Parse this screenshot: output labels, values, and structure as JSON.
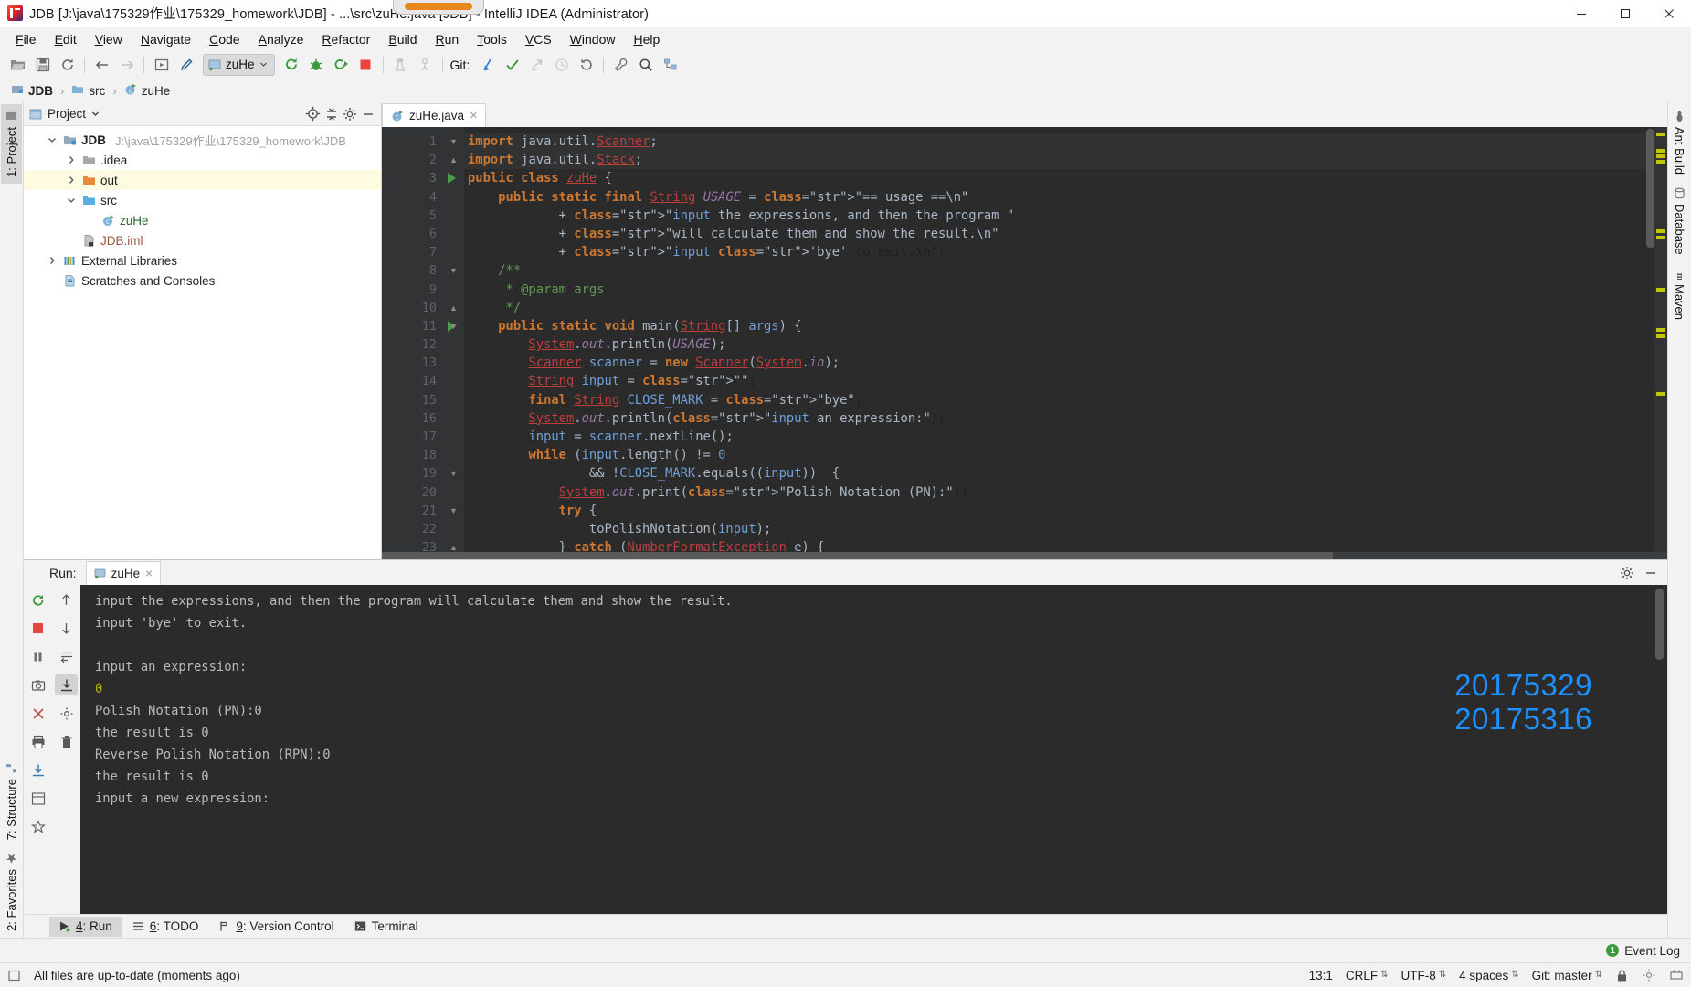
{
  "window": {
    "title": "JDB [J:\\java\\175329作业\\175329_homework\\JDB] - ...\\src\\zuHe.java [JDB] - IntelliJ IDEA (Administrator)",
    "minimize_label": "minimize",
    "maximize_label": "maximize",
    "close_label": "close"
  },
  "menu": {
    "items": [
      "File",
      "Edit",
      "View",
      "Navigate",
      "Code",
      "Analyze",
      "Refactor",
      "Build",
      "Run",
      "Tools",
      "VCS",
      "Window",
      "Help"
    ]
  },
  "toolbar": {
    "run_config": "zuHe",
    "git_label": "Git:",
    "buttons": [
      "open-project",
      "save-all",
      "sync",
      "back",
      "forward",
      "compile",
      "search-everywhere",
      "run",
      "debug",
      "run-with-coverage",
      "stop",
      "profile",
      "attach",
      "update-project",
      "commit",
      "push",
      "history",
      "rollback",
      "settings",
      "search",
      "structure"
    ]
  },
  "breadcrumb": {
    "items": [
      "JDB",
      "src",
      "zuHe"
    ]
  },
  "left_rail": {
    "tabs": [
      "1: Project",
      "7: Structure",
      "2: Favorites"
    ]
  },
  "right_rail": {
    "tabs": [
      "Ant Build",
      "Database",
      "Maven"
    ]
  },
  "project_panel": {
    "title": "Project",
    "tree": [
      {
        "name": "JDB",
        "path": "J:\\java\\175329作业\\175329_homework\\JDB",
        "indent": 0,
        "arrow": "down",
        "icon": "module-icon",
        "bold": true,
        "highlight": false
      },
      {
        "name": ".idea",
        "path": "",
        "indent": 1,
        "arrow": "right",
        "icon": "folder-icon",
        "bold": false,
        "highlight": false
      },
      {
        "name": "out",
        "path": "",
        "indent": 1,
        "arrow": "right",
        "icon": "folder-orange-icon",
        "bold": false,
        "highlight": true
      },
      {
        "name": "src",
        "path": "",
        "indent": 1,
        "arrow": "down",
        "icon": "folder-source-icon",
        "bold": false,
        "highlight": false
      },
      {
        "name": "zuHe",
        "path": "",
        "indent": 2,
        "arrow": "none",
        "icon": "java-class-icon",
        "bold": false,
        "highlight": false
      },
      {
        "name": "JDB.iml",
        "path": "",
        "indent": 1,
        "arrow": "none",
        "icon": "iml-file-icon",
        "bold": false,
        "highlight": false
      },
      {
        "name": "External Libraries",
        "path": "",
        "indent": 0,
        "arrow": "right",
        "icon": "libraries-icon",
        "bold": false,
        "highlight": false
      },
      {
        "name": "Scratches and Consoles",
        "path": "",
        "indent": 0,
        "arrow": "none",
        "icon": "scratches-icon",
        "bold": false,
        "highlight": false
      }
    ]
  },
  "editor": {
    "tab_label": "zuHe.java",
    "tab_close": "×",
    "first_line": 1,
    "lines": [
      {
        "n": 1,
        "marker": "fold-top",
        "text": "import java.util.Scanner;"
      },
      {
        "n": 2,
        "marker": "fold-bot",
        "text": "import java.util.Stack;"
      },
      {
        "n": 3,
        "marker": "run",
        "text": "public class zuHe {"
      },
      {
        "n": 4,
        "marker": "",
        "text": "    public static final String USAGE = \"== usage ==\\n\""
      },
      {
        "n": 5,
        "marker": "",
        "text": "            + \"input the expressions, and then the program \""
      },
      {
        "n": 6,
        "marker": "",
        "text": "            + \"will calculate them and show the result.\\n\""
      },
      {
        "n": 7,
        "marker": "",
        "text": "            + \"input 'bye' to exit.\\n\";"
      },
      {
        "n": 8,
        "marker": "fold-top",
        "text": "    /**"
      },
      {
        "n": 9,
        "marker": "",
        "text": "     * @param args"
      },
      {
        "n": 10,
        "marker": "fold-bot",
        "text": "     */"
      },
      {
        "n": 11,
        "marker": "run-fold",
        "text": "    public static void main(String[] args) {"
      },
      {
        "n": 12,
        "marker": "",
        "text": "        System.out.println(USAGE);"
      },
      {
        "n": 13,
        "marker": "",
        "text": "        Scanner scanner = new Scanner(System.in);"
      },
      {
        "n": 14,
        "marker": "",
        "text": "        String input = \"\";"
      },
      {
        "n": 15,
        "marker": "",
        "text": "        final String CLOSE_MARK = \"bye\";"
      },
      {
        "n": 16,
        "marker": "",
        "text": "        System.out.println(\"input an expression:\");"
      },
      {
        "n": 17,
        "marker": "",
        "text": "        input = scanner.nextLine();"
      },
      {
        "n": 18,
        "marker": "",
        "text": "        while (input.length() != 0"
      },
      {
        "n": 19,
        "marker": "fold-top",
        "text": "                && !CLOSE_MARK.equals((input))  {"
      },
      {
        "n": 20,
        "marker": "",
        "text": "            System.out.print(\"Polish Notation (PN):\");"
      },
      {
        "n": 21,
        "marker": "fold-top",
        "text": "            try {"
      },
      {
        "n": 22,
        "marker": "",
        "text": "                toPolishNotation(input);"
      },
      {
        "n": 23,
        "marker": "fold-bot",
        "text": "            } catch (NumberFormatException e) {"
      }
    ]
  },
  "run_panel": {
    "label": "Run:",
    "tab_label": "zuHe",
    "tab_close": "×",
    "console_lines": [
      {
        "text": "input the expressions, and then the program will calculate them and show the result.",
        "color": "normal"
      },
      {
        "text": "input 'bye' to exit.",
        "color": "normal"
      },
      {
        "text": "",
        "color": "normal"
      },
      {
        "text": "input an expression:",
        "color": "normal"
      },
      {
        "text": "0",
        "color": "yellow"
      },
      {
        "text": "Polish Notation (PN):0",
        "color": "normal"
      },
      {
        "text": "the result is 0",
        "color": "normal"
      },
      {
        "text": "Reverse Polish Notation (RPN):0",
        "color": "normal"
      },
      {
        "text": "the result is 0",
        "color": "normal"
      },
      {
        "text": "input a new expression:",
        "color": "normal"
      }
    ],
    "watermark": [
      "20175329",
      "20175316"
    ],
    "watermark_color": "#1e90ff"
  },
  "bottom_tabs": [
    {
      "label": "4: Run",
      "underline": "4",
      "icon": "run-icon",
      "selected": true
    },
    {
      "label": "6: TODO",
      "underline": "6",
      "icon": "todo-icon",
      "selected": false
    },
    {
      "label": "9: Version Control",
      "underline": "9",
      "icon": "vcs-icon",
      "selected": false
    },
    {
      "label": "Terminal",
      "underline": "",
      "icon": "terminal-icon",
      "selected": false
    }
  ],
  "status_bar": {
    "message": "All files are up-to-date (moments ago)",
    "event_log": "Event Log",
    "event_count": "1",
    "caret_position": "13:1",
    "line_separator": "CRLF",
    "encoding": "UTF-8",
    "indent": "4 spaces",
    "branch": "Git: master"
  }
}
